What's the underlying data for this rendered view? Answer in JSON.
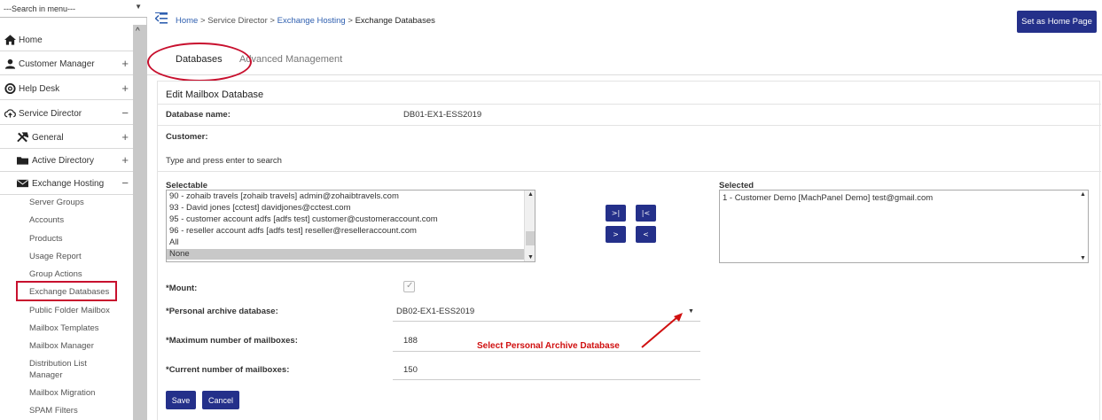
{
  "sidebar": {
    "search_text": "---Search in menu---",
    "top_items": [
      {
        "label": "Home",
        "toggle": ""
      },
      {
        "label": "Customer Manager",
        "toggle": "+"
      },
      {
        "label": "Help Desk",
        "toggle": "+"
      },
      {
        "label": "Service Director",
        "toggle": "−"
      }
    ],
    "sub_items": [
      {
        "label": "General",
        "toggle": "+"
      },
      {
        "label": "Active Directory",
        "toggle": "+"
      },
      {
        "label": "Exchange Hosting",
        "toggle": "−"
      }
    ],
    "exchange_items": [
      "Server Groups",
      "Accounts",
      "Products",
      "Usage Report",
      "Group Actions",
      "Exchange Databases",
      "Public Folder Mailbox",
      "Mailbox Templates",
      "Mailbox Manager",
      "Distribution List",
      "Manager",
      "Mailbox Migration",
      "SPAM Filters"
    ]
  },
  "breadcrumb": {
    "home": "Home",
    "sep": ">",
    "service_director": "Service Director",
    "exchange_hosting": "Exchange Hosting",
    "current": "Exchange Databases"
  },
  "header": {
    "home_button": "Set as Home Page"
  },
  "tabs": [
    {
      "label": "Databases",
      "active": true
    },
    {
      "label": "Advanced Management",
      "active": false
    }
  ],
  "form": {
    "title": "Edit Mailbox Database",
    "database_name_label": "Database name:",
    "database_name_value": "DB01-EX1-ESS2019",
    "customer_label": "Customer:",
    "search_placeholder": "Type and press enter to search",
    "selectable_label": "Selectable",
    "selectable_items": [
      "90 - zohaib travels [zohaib travels] admin@zohaibtravels.com",
      "93 - David jones [cctest] davidjones@cctest.com",
      "95 - customer account adfs [adfs test] customer@customeraccount.com",
      "96 - reseller account adfs [adfs test] reseller@reselleraccount.com",
      "All",
      "None"
    ],
    "selected_label": "Selected",
    "selected_items": [
      "1 - Customer Demo [MachPanel Demo] test@gmail.com"
    ],
    "move_all_right": ">|",
    "move_all_left": "|<",
    "move_right": ">",
    "move_left": "<",
    "mount_label": "*Mount:",
    "mount_checked": true,
    "archive_label": "*Personal archive database:",
    "archive_value": "DB02-EX1-ESS2019",
    "max_label": "*Maximum number of mailboxes:",
    "max_value": "188",
    "current_label": "*Current number of mailboxes:",
    "current_value": "150",
    "save_button": "Save",
    "cancel_button": "Cancel"
  },
  "annotation": "Select Personal Archive Database",
  "colors": {
    "primary": "#24308a",
    "annotation": "#d01010",
    "link": "#3060b0"
  }
}
